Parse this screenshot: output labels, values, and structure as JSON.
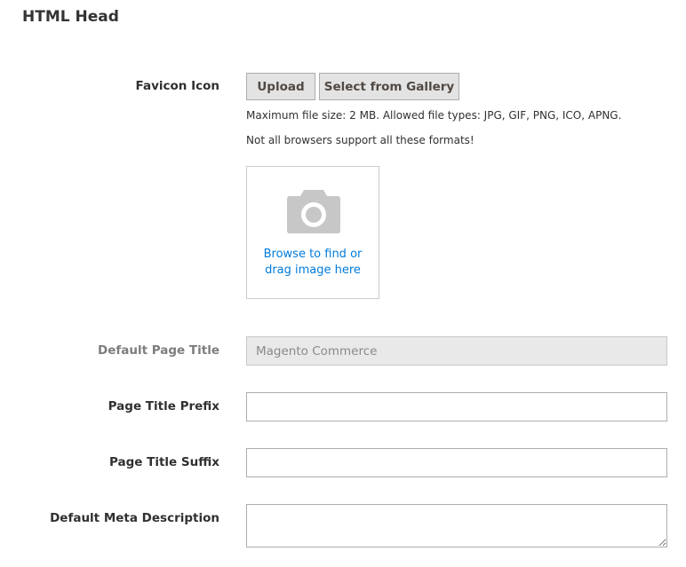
{
  "section": {
    "title": "HTML Head"
  },
  "favicon": {
    "label": "Favicon Icon",
    "upload_label": "Upload",
    "gallery_label": "Select from Gallery",
    "note_size": "Maximum file size: 2 MB. Allowed file types: JPG, GIF, PNG, ICO, APNG.",
    "note_browsers": "Not all browsers support all these formats!",
    "dropzone_line1": "Browse to find or",
    "dropzone_line2": "drag image here",
    "icon": "camera-icon"
  },
  "fields": {
    "default_title": {
      "label": "Default Page Title",
      "value": "Magento Commerce"
    },
    "title_prefix": {
      "label": "Page Title Prefix",
      "value": ""
    },
    "title_suffix": {
      "label": "Page Title Suffix",
      "value": ""
    },
    "meta_description": {
      "label": "Default Meta Description",
      "value": ""
    }
  },
  "colors": {
    "link": "#007bdb",
    "button_bg": "#e3e3e3",
    "disabled_bg": "#e9e9e9"
  }
}
